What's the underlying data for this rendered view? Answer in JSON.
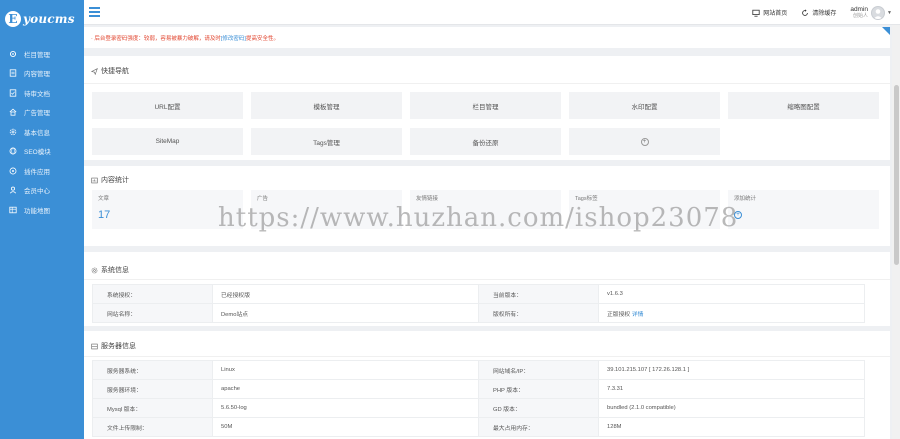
{
  "app": {
    "logo_text": "youcms",
    "logo_letter": "E"
  },
  "sidebar": {
    "items": [
      {
        "label": "栏目管理",
        "icon": "gear-icon"
      },
      {
        "label": "内容管理",
        "icon": "document-icon"
      },
      {
        "label": "待审文档",
        "icon": "file-check-icon"
      },
      {
        "label": "广告管理",
        "icon": "home-icon"
      },
      {
        "label": "基本信息",
        "icon": "settings-icon"
      },
      {
        "label": "SEO模块",
        "icon": "globe-icon"
      },
      {
        "label": "插件应用",
        "icon": "plugin-icon"
      },
      {
        "label": "会员中心",
        "icon": "user-icon"
      },
      {
        "label": "功能地图",
        "icon": "map-icon"
      }
    ]
  },
  "header": {
    "site_home": "网站首页",
    "clear_cache": "清除缓存",
    "username": "admin",
    "role": "创始人"
  },
  "notice": {
    "text": "· 后台登录密码强度：较弱，容易被暴力破解，请及时",
    "link": "[修改密码]",
    "suffix": "提高安全性。"
  },
  "quick_nav": {
    "title": "快捷导航",
    "items": [
      "URL配置",
      "模板管理",
      "栏目管理",
      "水印配置",
      "缩略图配置",
      "SiteMap",
      "Tags管理",
      "备份还原"
    ]
  },
  "content_stats": {
    "title": "内容统计",
    "items": [
      {
        "label": "文章",
        "value": "17"
      },
      {
        "label": "广告",
        "value": ""
      },
      {
        "label": "友情链接",
        "value": ""
      },
      {
        "label": "Tags标签",
        "value": ""
      },
      {
        "label": "添加统计",
        "value": ""
      }
    ]
  },
  "system_info": {
    "title": "系统信息",
    "rows": [
      {
        "k1": "系统授权：",
        "v1": "已经授权版",
        "k2": "当前版本：",
        "v2": "v1.6.3"
      },
      {
        "k1": "网站名称：",
        "v1": "Demo站点",
        "k2": "版权所有：",
        "v2": "正版授权",
        "v2_link": "详情"
      }
    ]
  },
  "server_info": {
    "title": "服务器信息",
    "rows": [
      {
        "k1": "服务器系统：",
        "v1": "Linux",
        "k2": "网站域名/IP：",
        "v2": "39.101.215.107 [ 172.26.128.1 ]"
      },
      {
        "k1": "服务器环境：",
        "v1": "apache",
        "k2": "PHP 版本：",
        "v2": "7.3.31"
      },
      {
        "k1": "Mysql 版本：",
        "v1": "5.6.50-log",
        "k2": "GD 版本：",
        "v2": "bundled (2.1.0 compatible)"
      },
      {
        "k1": "文件上传限制：",
        "v1": "50M",
        "k2": "最大占用内存：",
        "v2": "128M"
      }
    ]
  },
  "watermark": "https://www.huzhan.com/ishop23078",
  "colors": {
    "accent": "#3b8fd6",
    "warning": "#e1452f"
  }
}
